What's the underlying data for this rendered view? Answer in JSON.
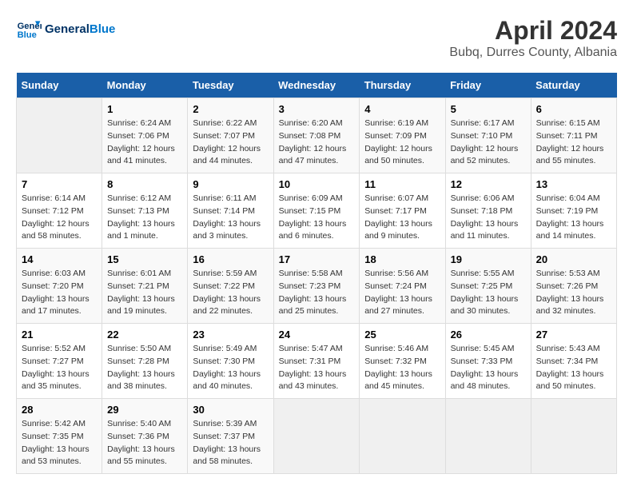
{
  "header": {
    "logo_line1": "General",
    "logo_line2": "Blue",
    "title": "April 2024",
    "subtitle": "Bubq, Durres County, Albania"
  },
  "calendar": {
    "weekdays": [
      "Sunday",
      "Monday",
      "Tuesday",
      "Wednesday",
      "Thursday",
      "Friday",
      "Saturday"
    ],
    "weeks": [
      [
        {
          "day": "",
          "info": ""
        },
        {
          "day": "1",
          "info": "Sunrise: 6:24 AM\nSunset: 7:06 PM\nDaylight: 12 hours\nand 41 minutes."
        },
        {
          "day": "2",
          "info": "Sunrise: 6:22 AM\nSunset: 7:07 PM\nDaylight: 12 hours\nand 44 minutes."
        },
        {
          "day": "3",
          "info": "Sunrise: 6:20 AM\nSunset: 7:08 PM\nDaylight: 12 hours\nand 47 minutes."
        },
        {
          "day": "4",
          "info": "Sunrise: 6:19 AM\nSunset: 7:09 PM\nDaylight: 12 hours\nand 50 minutes."
        },
        {
          "day": "5",
          "info": "Sunrise: 6:17 AM\nSunset: 7:10 PM\nDaylight: 12 hours\nand 52 minutes."
        },
        {
          "day": "6",
          "info": "Sunrise: 6:15 AM\nSunset: 7:11 PM\nDaylight: 12 hours\nand 55 minutes."
        }
      ],
      [
        {
          "day": "7",
          "info": "Sunrise: 6:14 AM\nSunset: 7:12 PM\nDaylight: 12 hours\nand 58 minutes."
        },
        {
          "day": "8",
          "info": "Sunrise: 6:12 AM\nSunset: 7:13 PM\nDaylight: 13 hours\nand 1 minute."
        },
        {
          "day": "9",
          "info": "Sunrise: 6:11 AM\nSunset: 7:14 PM\nDaylight: 13 hours\nand 3 minutes."
        },
        {
          "day": "10",
          "info": "Sunrise: 6:09 AM\nSunset: 7:15 PM\nDaylight: 13 hours\nand 6 minutes."
        },
        {
          "day": "11",
          "info": "Sunrise: 6:07 AM\nSunset: 7:17 PM\nDaylight: 13 hours\nand 9 minutes."
        },
        {
          "day": "12",
          "info": "Sunrise: 6:06 AM\nSunset: 7:18 PM\nDaylight: 13 hours\nand 11 minutes."
        },
        {
          "day": "13",
          "info": "Sunrise: 6:04 AM\nSunset: 7:19 PM\nDaylight: 13 hours\nand 14 minutes."
        }
      ],
      [
        {
          "day": "14",
          "info": "Sunrise: 6:03 AM\nSunset: 7:20 PM\nDaylight: 13 hours\nand 17 minutes."
        },
        {
          "day": "15",
          "info": "Sunrise: 6:01 AM\nSunset: 7:21 PM\nDaylight: 13 hours\nand 19 minutes."
        },
        {
          "day": "16",
          "info": "Sunrise: 5:59 AM\nSunset: 7:22 PM\nDaylight: 13 hours\nand 22 minutes."
        },
        {
          "day": "17",
          "info": "Sunrise: 5:58 AM\nSunset: 7:23 PM\nDaylight: 13 hours\nand 25 minutes."
        },
        {
          "day": "18",
          "info": "Sunrise: 5:56 AM\nSunset: 7:24 PM\nDaylight: 13 hours\nand 27 minutes."
        },
        {
          "day": "19",
          "info": "Sunrise: 5:55 AM\nSunset: 7:25 PM\nDaylight: 13 hours\nand 30 minutes."
        },
        {
          "day": "20",
          "info": "Sunrise: 5:53 AM\nSunset: 7:26 PM\nDaylight: 13 hours\nand 32 minutes."
        }
      ],
      [
        {
          "day": "21",
          "info": "Sunrise: 5:52 AM\nSunset: 7:27 PM\nDaylight: 13 hours\nand 35 minutes."
        },
        {
          "day": "22",
          "info": "Sunrise: 5:50 AM\nSunset: 7:28 PM\nDaylight: 13 hours\nand 38 minutes."
        },
        {
          "day": "23",
          "info": "Sunrise: 5:49 AM\nSunset: 7:30 PM\nDaylight: 13 hours\nand 40 minutes."
        },
        {
          "day": "24",
          "info": "Sunrise: 5:47 AM\nSunset: 7:31 PM\nDaylight: 13 hours\nand 43 minutes."
        },
        {
          "day": "25",
          "info": "Sunrise: 5:46 AM\nSunset: 7:32 PM\nDaylight: 13 hours\nand 45 minutes."
        },
        {
          "day": "26",
          "info": "Sunrise: 5:45 AM\nSunset: 7:33 PM\nDaylight: 13 hours\nand 48 minutes."
        },
        {
          "day": "27",
          "info": "Sunrise: 5:43 AM\nSunset: 7:34 PM\nDaylight: 13 hours\nand 50 minutes."
        }
      ],
      [
        {
          "day": "28",
          "info": "Sunrise: 5:42 AM\nSunset: 7:35 PM\nDaylight: 13 hours\nand 53 minutes."
        },
        {
          "day": "29",
          "info": "Sunrise: 5:40 AM\nSunset: 7:36 PM\nDaylight: 13 hours\nand 55 minutes."
        },
        {
          "day": "30",
          "info": "Sunrise: 5:39 AM\nSunset: 7:37 PM\nDaylight: 13 hours\nand 58 minutes."
        },
        {
          "day": "",
          "info": ""
        },
        {
          "day": "",
          "info": ""
        },
        {
          "day": "",
          "info": ""
        },
        {
          "day": "",
          "info": ""
        }
      ]
    ]
  }
}
